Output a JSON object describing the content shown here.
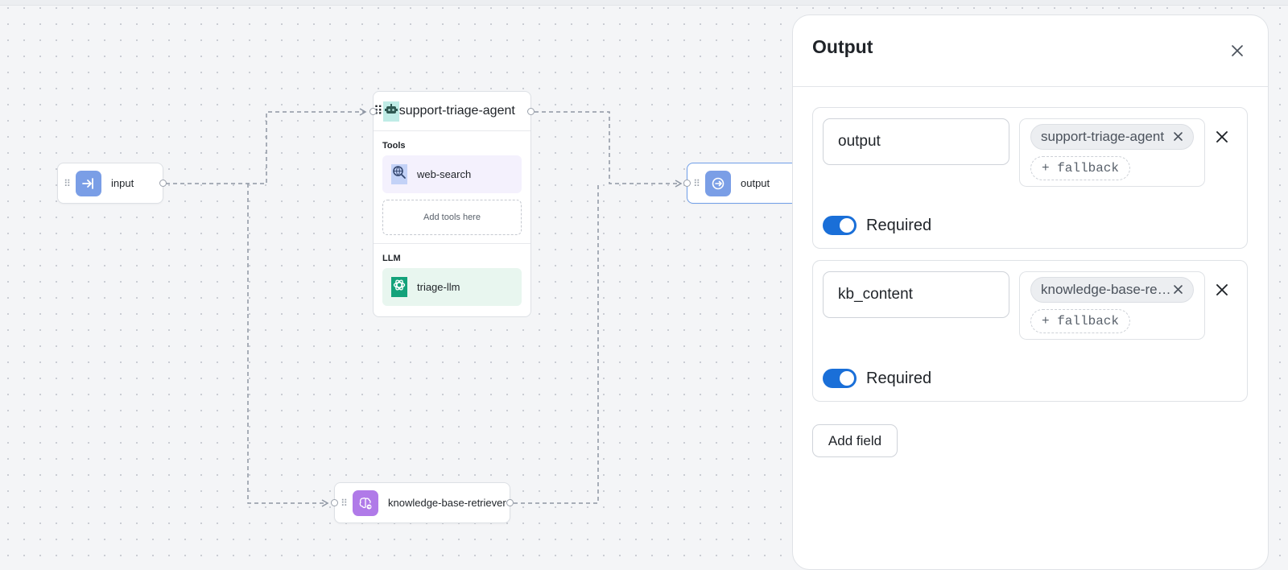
{
  "canvas": {
    "nodes": {
      "input": {
        "label": "input"
      },
      "agent": {
        "label": "support-triage-agent",
        "tools_heading": "Tools",
        "tool": {
          "label": "web-search"
        },
        "add_tools": "Add tools here",
        "llm_heading": "LLM",
        "llm": {
          "label": "triage-llm"
        }
      },
      "output": {
        "label": "output"
      },
      "retriever": {
        "label": "knowledge-base-retriever"
      }
    }
  },
  "panel": {
    "title": "Output",
    "fields": [
      {
        "name": "output",
        "source": "support-triage-agent",
        "fallback_label": "+ fallback",
        "required_label": "Required",
        "required": true
      },
      {
        "name": "kb_content",
        "source": "knowledge-base-retriever",
        "fallback_label": "+ fallback",
        "required_label": "Required",
        "required": true
      }
    ],
    "add_field_label": "Add field"
  },
  "colors": {
    "accent": "#1a6fd8",
    "node_input_icon": "#7a9ee6",
    "node_agent_icon": "#bfece6",
    "node_tool_bg": "#f4f1fd",
    "node_llm_bg": "#e8f6ef",
    "node_llm_icon": "#13a27a",
    "node_retriever_icon": "#b07ae8"
  }
}
